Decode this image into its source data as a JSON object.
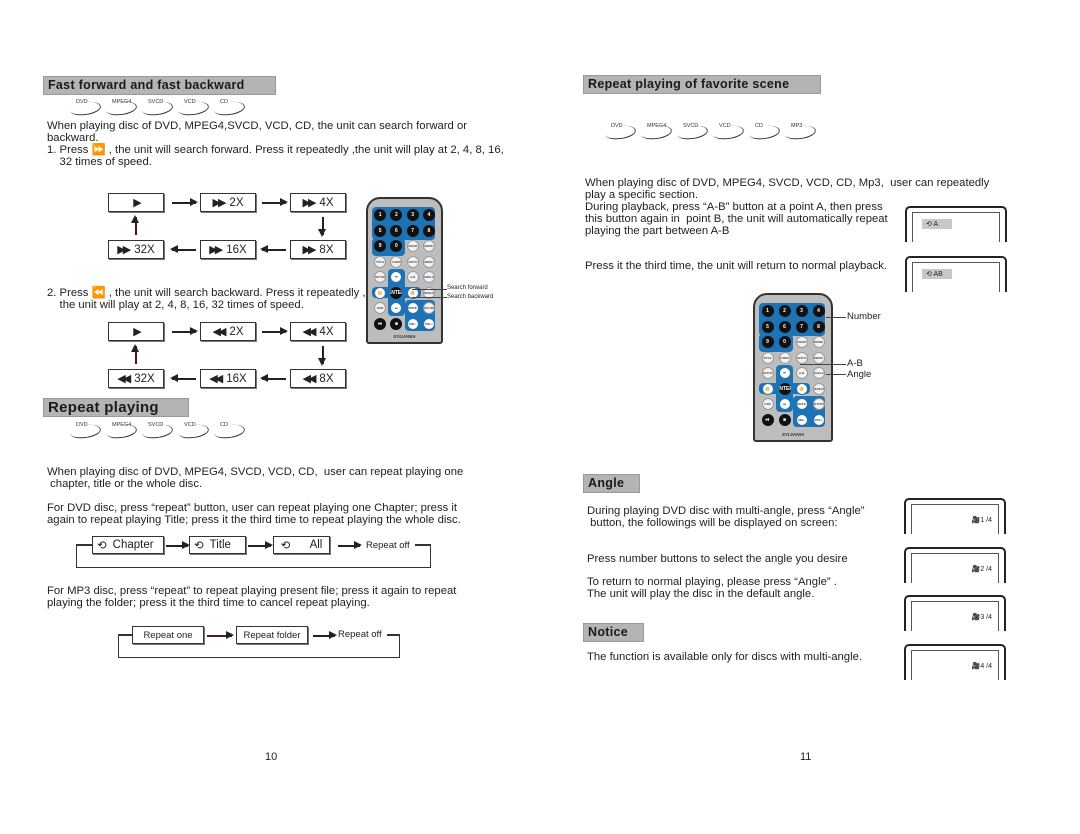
{
  "left": {
    "ff": {
      "title": "Fast forward and fast backward",
      "discs": [
        "DVD",
        "MPEG4",
        "SVCD",
        "VCD",
        "CD"
      ],
      "intro": [
        "When playing disc of DVD, MPEG4,SVCD, VCD, CD, the unit can search forward or",
        "backward."
      ],
      "step1": [
        "1. Press ⏩ , the unit will search forward. Press it repeatedly ,the unit will play at 2, 4, 8, 16,",
        "    32 times of speed."
      ],
      "step2": [
        "2. Press ⏪ , the unit will search backward. Press it repeatedly ,",
        "    the unit will play at 2, 4, 8, 16, 32 times of speed."
      ],
      "forward": [
        "",
        "2X",
        "4X",
        "8X",
        "16X",
        "32X"
      ],
      "backward": [
        "",
        "2X",
        "4X",
        "8X",
        "16X",
        "32X"
      ],
      "callouts": [
        "Search forward",
        "Search backward"
      ]
    },
    "repeat": {
      "title": "Repeat playing",
      "discs": [
        "DVD",
        "MPEG4",
        "SVCD",
        "VCD",
        "CD"
      ],
      "p1": [
        "When playing disc of DVD, MPEG4, SVCD, VCD, CD,  user can repeat playing one",
        " chapter, title or the whole disc."
      ],
      "p2": [
        "For DVD disc, press “repeat” button, user can repeat playing one Chapter; press it",
        "again to repeat playing Title; press it the third time to repeat playing the whole disc."
      ],
      "dvd_flow": [
        "Chapter",
        "Title",
        "All",
        "Repeat off"
      ],
      "p3": [
        "For MP3 disc, press “repeat” to repeat playing present file; press it again to repeat",
        "playing the folder; press it the third time to cancel repeat playing."
      ],
      "mp3_flow": [
        "Repeat one",
        "Repeat folder",
        "Repeat off"
      ]
    },
    "page": "10"
  },
  "right": {
    "scene": {
      "title": "Repeat playing of favorite scene",
      "discs": [
        "DVD",
        "MPEG4",
        "SVCD",
        "VCD",
        "CD",
        "MP3"
      ],
      "p1": [
        "When playing disc of DVD, MPEG4, SVCD, VCD, CD, Mp3,  user can repeatedly",
        "play a specific section.",
        "During playback, press “A-B” button at a point A, then press",
        "this button again in  point B, the unit will automatically repeat",
        "playing the part between A-B"
      ],
      "p2": "Press it the third time, the unit will return to normal playback.",
      "osd": [
        "A",
        "AB"
      ],
      "callouts": [
        "Number",
        "A-B",
        "Angle"
      ]
    },
    "angle": {
      "title": "Angle",
      "p1": [
        "During playing DVD disc with multi-angle, press “Angle”",
        " button, the followings will be displayed on screen:"
      ],
      "p2": "Press number buttons to select the angle you desire",
      "p3": [
        "To return to normal playing, please press “Angle” .",
        "The unit will play the disc in the default angle."
      ],
      "screens": [
        "1 /4",
        "2 /4",
        "3 /4",
        "4 /4"
      ]
    },
    "notice": {
      "title": "Notice",
      "text": "The function is available only for discs with multi-angle."
    },
    "page": "11"
  },
  "remote": {
    "brand": "SYLVANIA",
    "keys": [
      "1",
      "2",
      "3",
      "4",
      "5",
      "6",
      "7",
      "8",
      "9",
      "0",
      "ZOOM",
      "MODE",
      "TITLE",
      "AUDIO",
      "SUBTITLE",
      "MENU",
      "SETUP",
      "⏮",
      "A-B",
      "ANGLE",
      "⏪",
      "ENTER",
      "⏩",
      "REPEAT",
      "OSD",
      "⏭",
      "MUTE",
      "RETURN",
      "⏯",
      "■",
      "VOL-",
      "VOL+"
    ],
    "accent": "#1e73b5"
  }
}
